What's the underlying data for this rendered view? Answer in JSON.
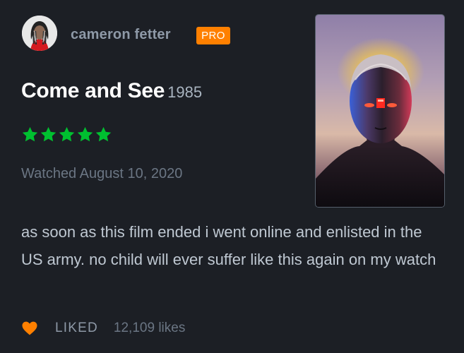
{
  "reviewer": {
    "name": "cameron fetter",
    "badge": "PRO"
  },
  "film": {
    "title": "Come and See",
    "year": "1985"
  },
  "rating": {
    "stars": 5,
    "max": 5,
    "star_color": "#00c030"
  },
  "watched": "Watched August 10, 2020",
  "review": {
    "text": "as soon as this film ended i went online and enlisted in the US army. no child will ever suffer like this again on my watch"
  },
  "footer": {
    "liked_label": "LIKED",
    "likes": "12,109 likes",
    "heart_color": "#ff8000"
  },
  "icons": {
    "avatar": "user-avatar",
    "poster": "film-poster",
    "star": "star-icon",
    "heart": "heart-icon"
  }
}
